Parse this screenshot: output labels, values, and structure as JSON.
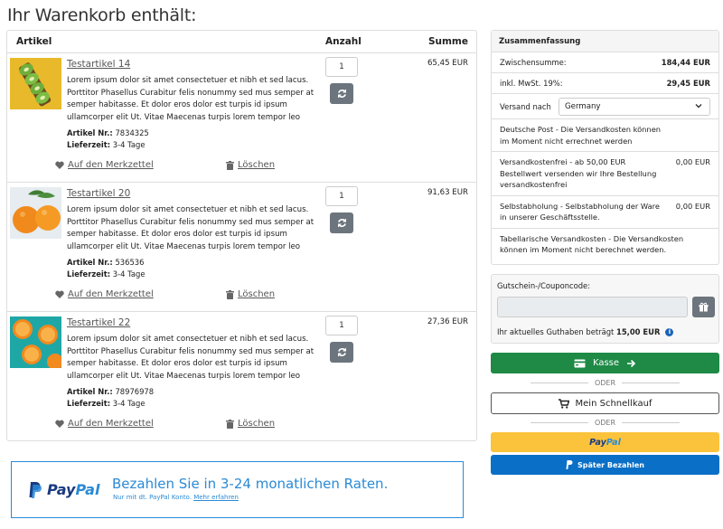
{
  "page": {
    "title": "Ihr Warenkorb enthält:"
  },
  "cart": {
    "columns": {
      "article": "Artikel",
      "quantity": "Anzahl",
      "sum": "Summe"
    },
    "items": [
      {
        "name": "Testartikel 14",
        "description": "Lorem ipsum dolor sit amet consectetuer et nibh et sed lacus. Porttitor Phasellus Curabitur felis nonummy sed mus semper at semper habitasse. Et dolor eros dolor est turpis id ipsum ullamcorper elit Ut. Vitae Maecenas turpis lorem tempor leo congu...",
        "article_no_label": "Artikel Nr.:",
        "article_no": "7834325",
        "delivery_label": "Lieferzeit:",
        "delivery": "3-4 Tage",
        "quantity": "1",
        "price": "65,45 EUR",
        "image": "kiwi-image"
      },
      {
        "name": "Testartikel 20",
        "description": "Lorem ipsum dolor sit amet consectetuer et nibh et sed lacus. Porttitor Phasellus Curabitur felis nonummy sed mus semper at semper habitasse. Et dolor eros dolor est turpis id ipsum ullamcorper elit Ut. Vitae Maecenas turpis lorem tempor leo congu...",
        "article_no_label": "Artikel Nr.:",
        "article_no": "536536",
        "delivery_label": "Lieferzeit:",
        "delivery": "3-4 Tage",
        "quantity": "1",
        "price": "91,63 EUR",
        "image": "oranges-image"
      },
      {
        "name": "Testartikel 22",
        "description": "Lorem ipsum dolor sit amet consectetuer et nibh et sed lacus. Porttitor Phasellus Curabitur felis nonummy sed mus semper at semper habitasse. Et dolor eros dolor est turpis id ipsum ullamcorper elit Ut. Vitae Maecenas turpis lorem tempor leo congu...",
        "article_no_label": "Artikel Nr.:",
        "article_no": "78976978",
        "delivery_label": "Lieferzeit:",
        "delivery": "3-4 Tage",
        "quantity": "1",
        "price": "27,36 EUR",
        "image": "orange-slices-image"
      }
    ],
    "wishlist_label": "Auf den Merkzettel",
    "delete_label": "Löschen"
  },
  "summary": {
    "title": "Zusammenfassung",
    "subtotal_label": "Zwischensumme:",
    "subtotal": "184,44 EUR",
    "tax_label": "inkl. MwSt. 19%:",
    "tax": "29,45 EUR",
    "shipping_label": "Versand nach",
    "shipping_country": "Germany",
    "options": [
      {
        "text": "Deutsche Post - Die Versandkosten können im Moment nicht errechnet werden",
        "value": ""
      },
      {
        "text": "Versandkostenfrei - ab 50,00 EUR Bestellwert versenden wir Ihre Bestellung versandkostenfrei",
        "value": "0,00 EUR"
      },
      {
        "text": "Selbstabholung - Selbstabholung der Ware in unserer Geschäftsstelle.",
        "value": "0,00 EUR"
      },
      {
        "text": "Tabellarische Versandkosten - Die Versandkosten können im Moment nicht berechnet werden.",
        "value": ""
      }
    ]
  },
  "voucher": {
    "label": "Gutschein-/Couponcode:",
    "input_value": "",
    "balance_text": "Ihr aktuelles Guthaben beträgt",
    "balance": "15,00 EUR"
  },
  "checkout": {
    "kasse_label": "Kasse",
    "or_label": "ODER",
    "quickbuy_label": "Mein Schnellkauf",
    "paypal_pay": "Pay",
    "paypal_pal": "Pal",
    "later_label": "Später Bezahlen"
  },
  "banner": {
    "logo_pay": "Pay",
    "logo_pal": "Pal",
    "headline": "Bezahlen Sie in 3-24 monatlichen Raten.",
    "sub_text": "Nur mit dt. PayPal Konto.",
    "sub_link": "Mehr erfahren"
  },
  "colors": {
    "primary_green": "#1e8a46",
    "paypal_yellow": "#fbc33c",
    "paypal_blue": "#0a6fc6",
    "button_gray": "#6c757d"
  }
}
